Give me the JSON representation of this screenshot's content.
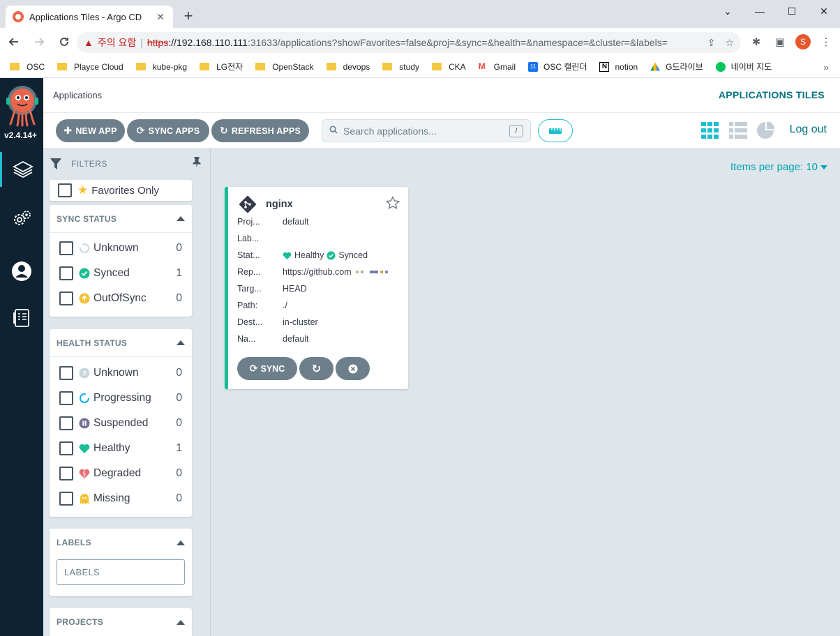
{
  "browser": {
    "tab_title": "Applications Tiles - Argo CD",
    "tab_close": "✕",
    "new_tab": "+",
    "security_warning": "주의 요함",
    "url_protocol": "https",
    "url_host": "://192.168.110.111",
    "url_rest": ":31633/applications?showFavorites=false&proj=&sync=&health=&namespace=&cluster=&labels=",
    "profile_initial": "S",
    "bookmarks": [
      {
        "label": "OSC",
        "icon": "folder-icon"
      },
      {
        "label": "Playce Cloud",
        "icon": "folder-icon"
      },
      {
        "label": "kube-pkg",
        "icon": "folder-icon"
      },
      {
        "label": "LG전자",
        "icon": "folder-icon"
      },
      {
        "label": "OpenStack",
        "icon": "folder-icon"
      },
      {
        "label": "devops",
        "icon": "folder-icon"
      },
      {
        "label": "study",
        "icon": "folder-icon"
      },
      {
        "label": "CKA",
        "icon": "folder-icon"
      },
      {
        "label": "Gmail",
        "icon": "gmail-icon"
      },
      {
        "label": "OSC 캘린더",
        "icon": "calendar-icon"
      },
      {
        "label": "notion",
        "icon": "notion-icon"
      },
      {
        "label": "G드라이브",
        "icon": "google-drive-icon"
      },
      {
        "label": "네이버 지도",
        "icon": "naver-map-icon"
      }
    ],
    "bookmarks_more": "»"
  },
  "sidebar": {
    "version": "v2.4.14+",
    "items": [
      {
        "name": "applications",
        "icon": "layers-icon",
        "active": true
      },
      {
        "name": "settings",
        "icon": "gears-icon",
        "active": false
      },
      {
        "name": "user-info",
        "icon": "user-icon",
        "active": false
      },
      {
        "name": "documentation",
        "icon": "book-icon",
        "active": false
      }
    ]
  },
  "header": {
    "breadcrumb": "Applications",
    "title": "APPLICATIONS TILES"
  },
  "toolbar": {
    "new_app": "NEW APP",
    "sync_apps": "SYNC APPS",
    "refresh_apps": "REFRESH APPS",
    "search_placeholder": "Search applications...",
    "search_shortcut": "/",
    "logout": "Log out"
  },
  "filters": {
    "title": "FILTERS",
    "favorites_only": "Favorites Only",
    "sync_status": {
      "title": "SYNC STATUS",
      "items": [
        {
          "label": "Unknown",
          "count": "0",
          "color": "#ccd6dd"
        },
        {
          "label": "Synced",
          "count": "1",
          "color": "#18be94"
        },
        {
          "label": "OutOfSync",
          "count": "0",
          "color": "#f4c030"
        }
      ]
    },
    "health_status": {
      "title": "HEALTH STATUS",
      "items": [
        {
          "label": "Unknown",
          "count": "0",
          "color": "#ccd6dd"
        },
        {
          "label": "Progressing",
          "count": "0",
          "color": "#0dadea"
        },
        {
          "label": "Suspended",
          "count": "0",
          "color": "#766f94"
        },
        {
          "label": "Healthy",
          "count": "1",
          "color": "#18be94"
        },
        {
          "label": "Degraded",
          "count": "0",
          "color": "#e96d76"
        },
        {
          "label": "Missing",
          "count": "0",
          "color": "#f4c030"
        }
      ]
    },
    "labels": {
      "title": "LABELS",
      "placeholder": "LABELS"
    },
    "projects": {
      "title": "PROJECTS"
    }
  },
  "main": {
    "items_per_page": "Items per page: 10",
    "app": {
      "name": "nginx",
      "rows": [
        {
          "key": "Proj...",
          "value": "default"
        },
        {
          "key": "Lab...",
          "value": ""
        },
        {
          "key": "Stat...",
          "value": ""
        },
        {
          "key": "Rep...",
          "value": "https://github.com"
        },
        {
          "key": "Targ...",
          "value": "HEAD"
        },
        {
          "key": "Path:",
          "value": "./"
        },
        {
          "key": "Dest...",
          "value": "in-cluster"
        },
        {
          "key": "Na...",
          "value": "default"
        }
      ],
      "health": "Healthy",
      "sync": "Synced",
      "sync_button": "SYNC"
    }
  },
  "colors": {
    "nav_bg": "#0e2232",
    "accent": "#00a2b3",
    "button_gray": "#6d7f8b",
    "healthy_green": "#18be94"
  }
}
